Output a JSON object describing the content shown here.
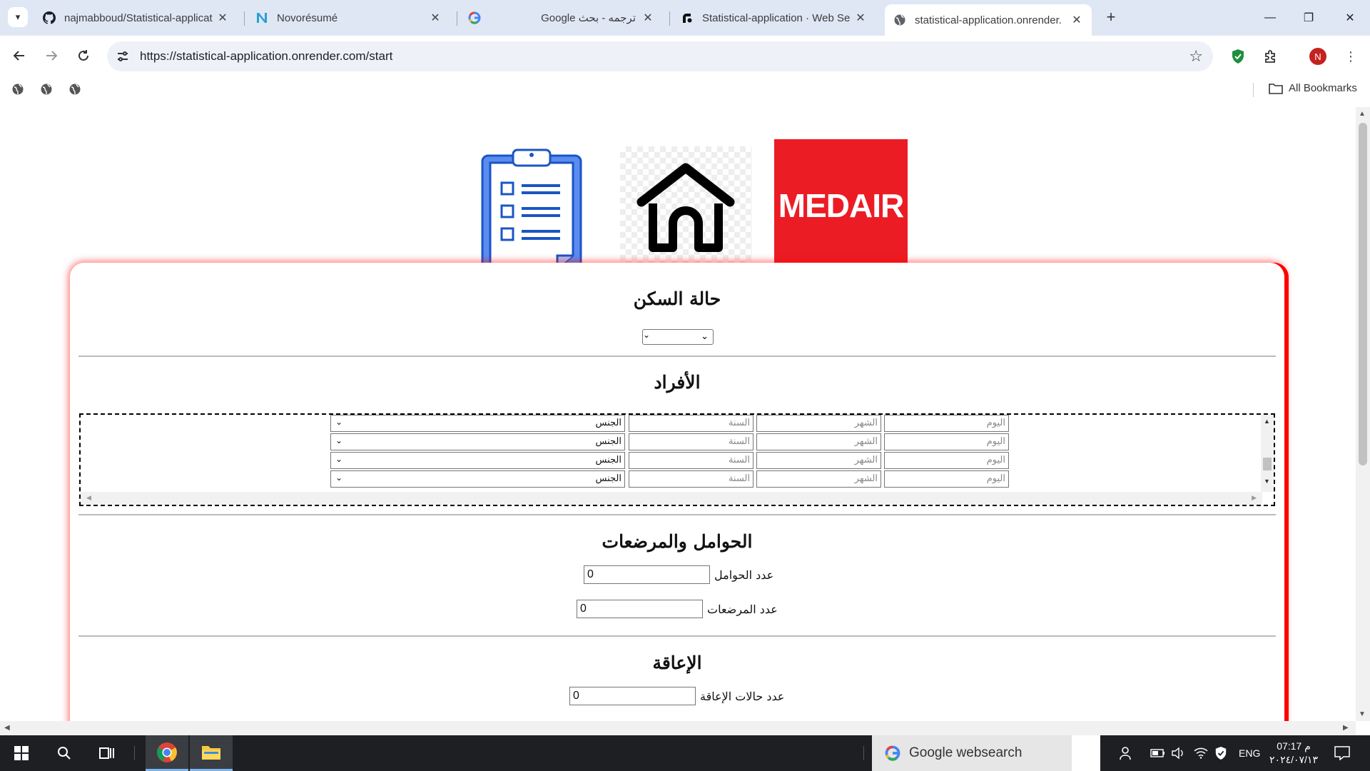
{
  "browser": {
    "tabs": [
      {
        "title": "najmabboud/Statistical-applicat",
        "favicon": "github-icon",
        "active": false
      },
      {
        "title": "Novorésumé",
        "favicon": "novoresume-icon",
        "active": false
      },
      {
        "title": "ترجمه - بحث Google",
        "favicon": "google-icon",
        "active": false
      },
      {
        "title": "Statistical-application · Web Se",
        "favicon": "render-icon",
        "active": false
      },
      {
        "title": "statistical-application.onrender.",
        "favicon": "globe-icon",
        "active": true
      }
    ],
    "url": "https://statistical-application.onrender.com/start",
    "profile_initial": "N",
    "bookmarks_label": "All Bookmarks"
  },
  "page": {
    "logos": {
      "medair_text": "MEDAIR"
    },
    "housing": {
      "title": "حالة السكن",
      "selected": ""
    },
    "members": {
      "title": "الأفراد",
      "placeholders": {
        "day": "اليوم",
        "month": "الشهر",
        "year": "السنة",
        "gender": "الجنس"
      },
      "rows": [
        {
          "gender": "الجنس",
          "year": "السنة",
          "month": "الشهر",
          "day": "اليوم"
        },
        {
          "gender": "الجنس",
          "year": "السنة",
          "month": "الشهر",
          "day": "اليوم"
        },
        {
          "gender": "الجنس",
          "year": "السنة",
          "month": "الشهر",
          "day": "اليوم"
        },
        {
          "gender": "الجنس",
          "year": "السنة",
          "month": "الشهر",
          "day": "اليوم"
        }
      ]
    },
    "pregnant": {
      "title": "الحوامل والمرضعات",
      "pregnant_label": "عدد الحوامل",
      "pregnant_value": "0",
      "nursing_label": "عدد المرضعات",
      "nursing_value": "0"
    },
    "disability": {
      "title": "الإعاقة",
      "count_label": "عدد حالات الإعاقة",
      "count_value": "0"
    }
  },
  "taskbar": {
    "search_text": "Google websearch",
    "language": "ENG",
    "time": "07:17 م",
    "date": "٢٠٢٤/٠٧/١٣"
  },
  "colors": {
    "medair_red": "#ec1c24",
    "card_glow": "#ff0000",
    "tabstrip": "#dfe7f4"
  }
}
